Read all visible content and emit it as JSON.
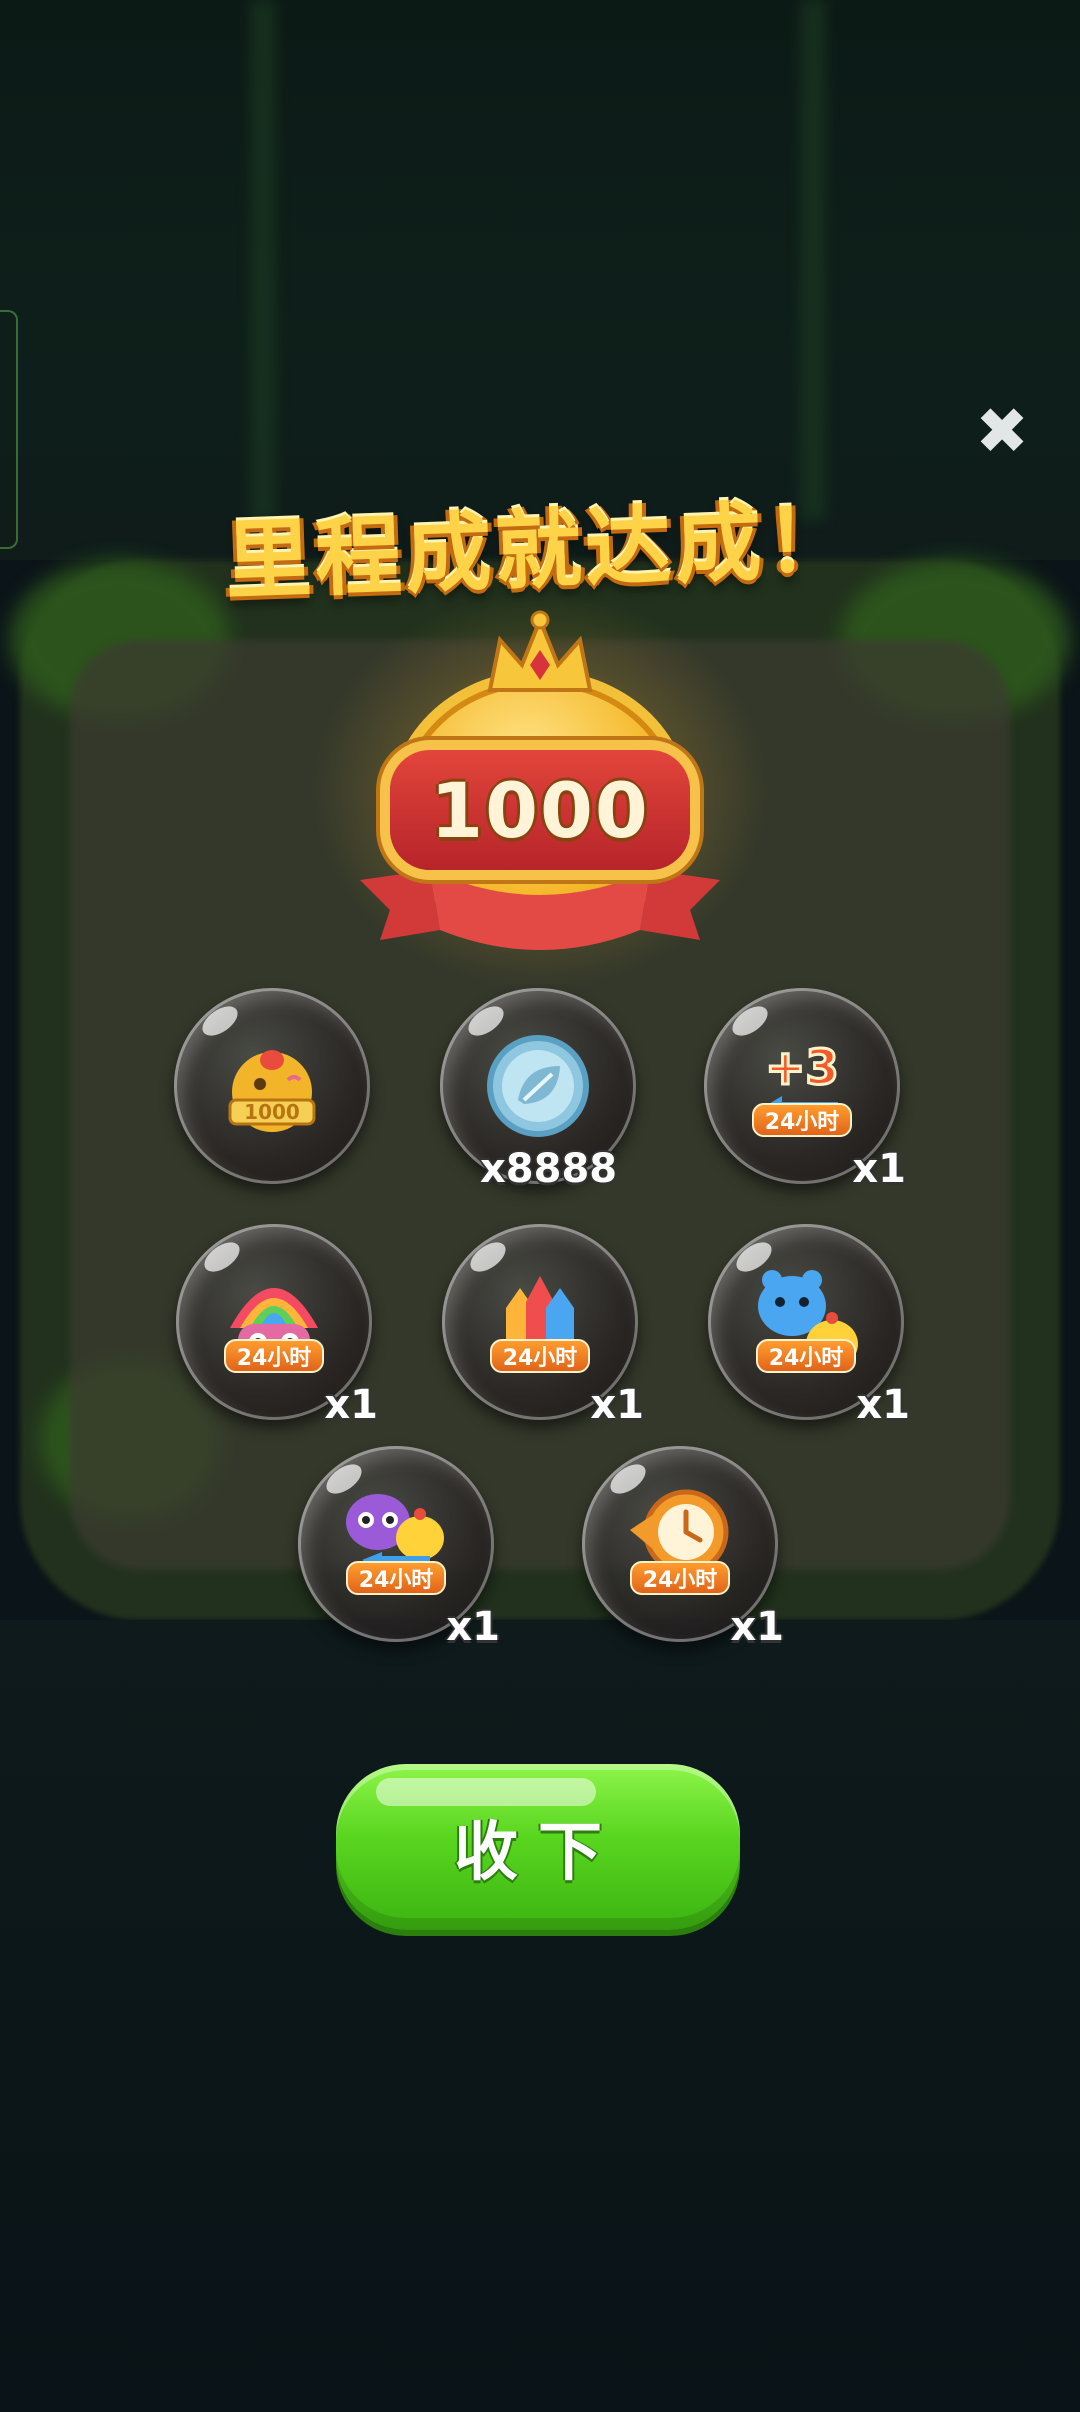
{
  "dialog": {
    "title": "里程成就达成！",
    "milestone": "1000",
    "close_icon": "close-icon",
    "collect_label": "收下"
  },
  "rewards": [
    {
      "icon": "chicken-1000-trophy-icon",
      "tag": "",
      "qty": ""
    },
    {
      "icon": "leaf-coin-icon",
      "tag": "",
      "qty": "x8888"
    },
    {
      "icon": "plus3-moves-icon",
      "tag": "24小时",
      "qty": "x1",
      "icon_text": "+3"
    },
    {
      "icon": "rainbow-owl-icon",
      "tag": "24小时",
      "qty": "x1"
    },
    {
      "icon": "firework-rockets-icon",
      "tag": "24小时",
      "qty": "x1"
    },
    {
      "icon": "blue-bear-chick-icon",
      "tag": "24小时",
      "qty": "x1"
    },
    {
      "icon": "purple-owl-chick-icon",
      "tag": "24小时",
      "qty": "x1"
    },
    {
      "icon": "time-clock-icon",
      "tag": "24小时",
      "qty": "x1"
    }
  ],
  "colors": {
    "title": "#ffd347",
    "button": "#58d51f",
    "tag": "#ff9d2f"
  }
}
